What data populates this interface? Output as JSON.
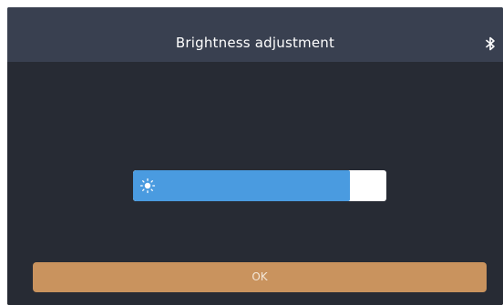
{
  "header": {
    "title": "Brightness adjustment",
    "status_icon": "bluetooth-icon"
  },
  "brightness": {
    "icon": "sun-icon",
    "level_fraction": 0.855
  },
  "footer": {
    "ok_label": "OK"
  },
  "colors": {
    "header_bg": "#394050",
    "content_bg": "#272b34",
    "slider_fill": "#4a9be0",
    "slider_track": "#ffffff",
    "ok_button": "#c9935e"
  }
}
